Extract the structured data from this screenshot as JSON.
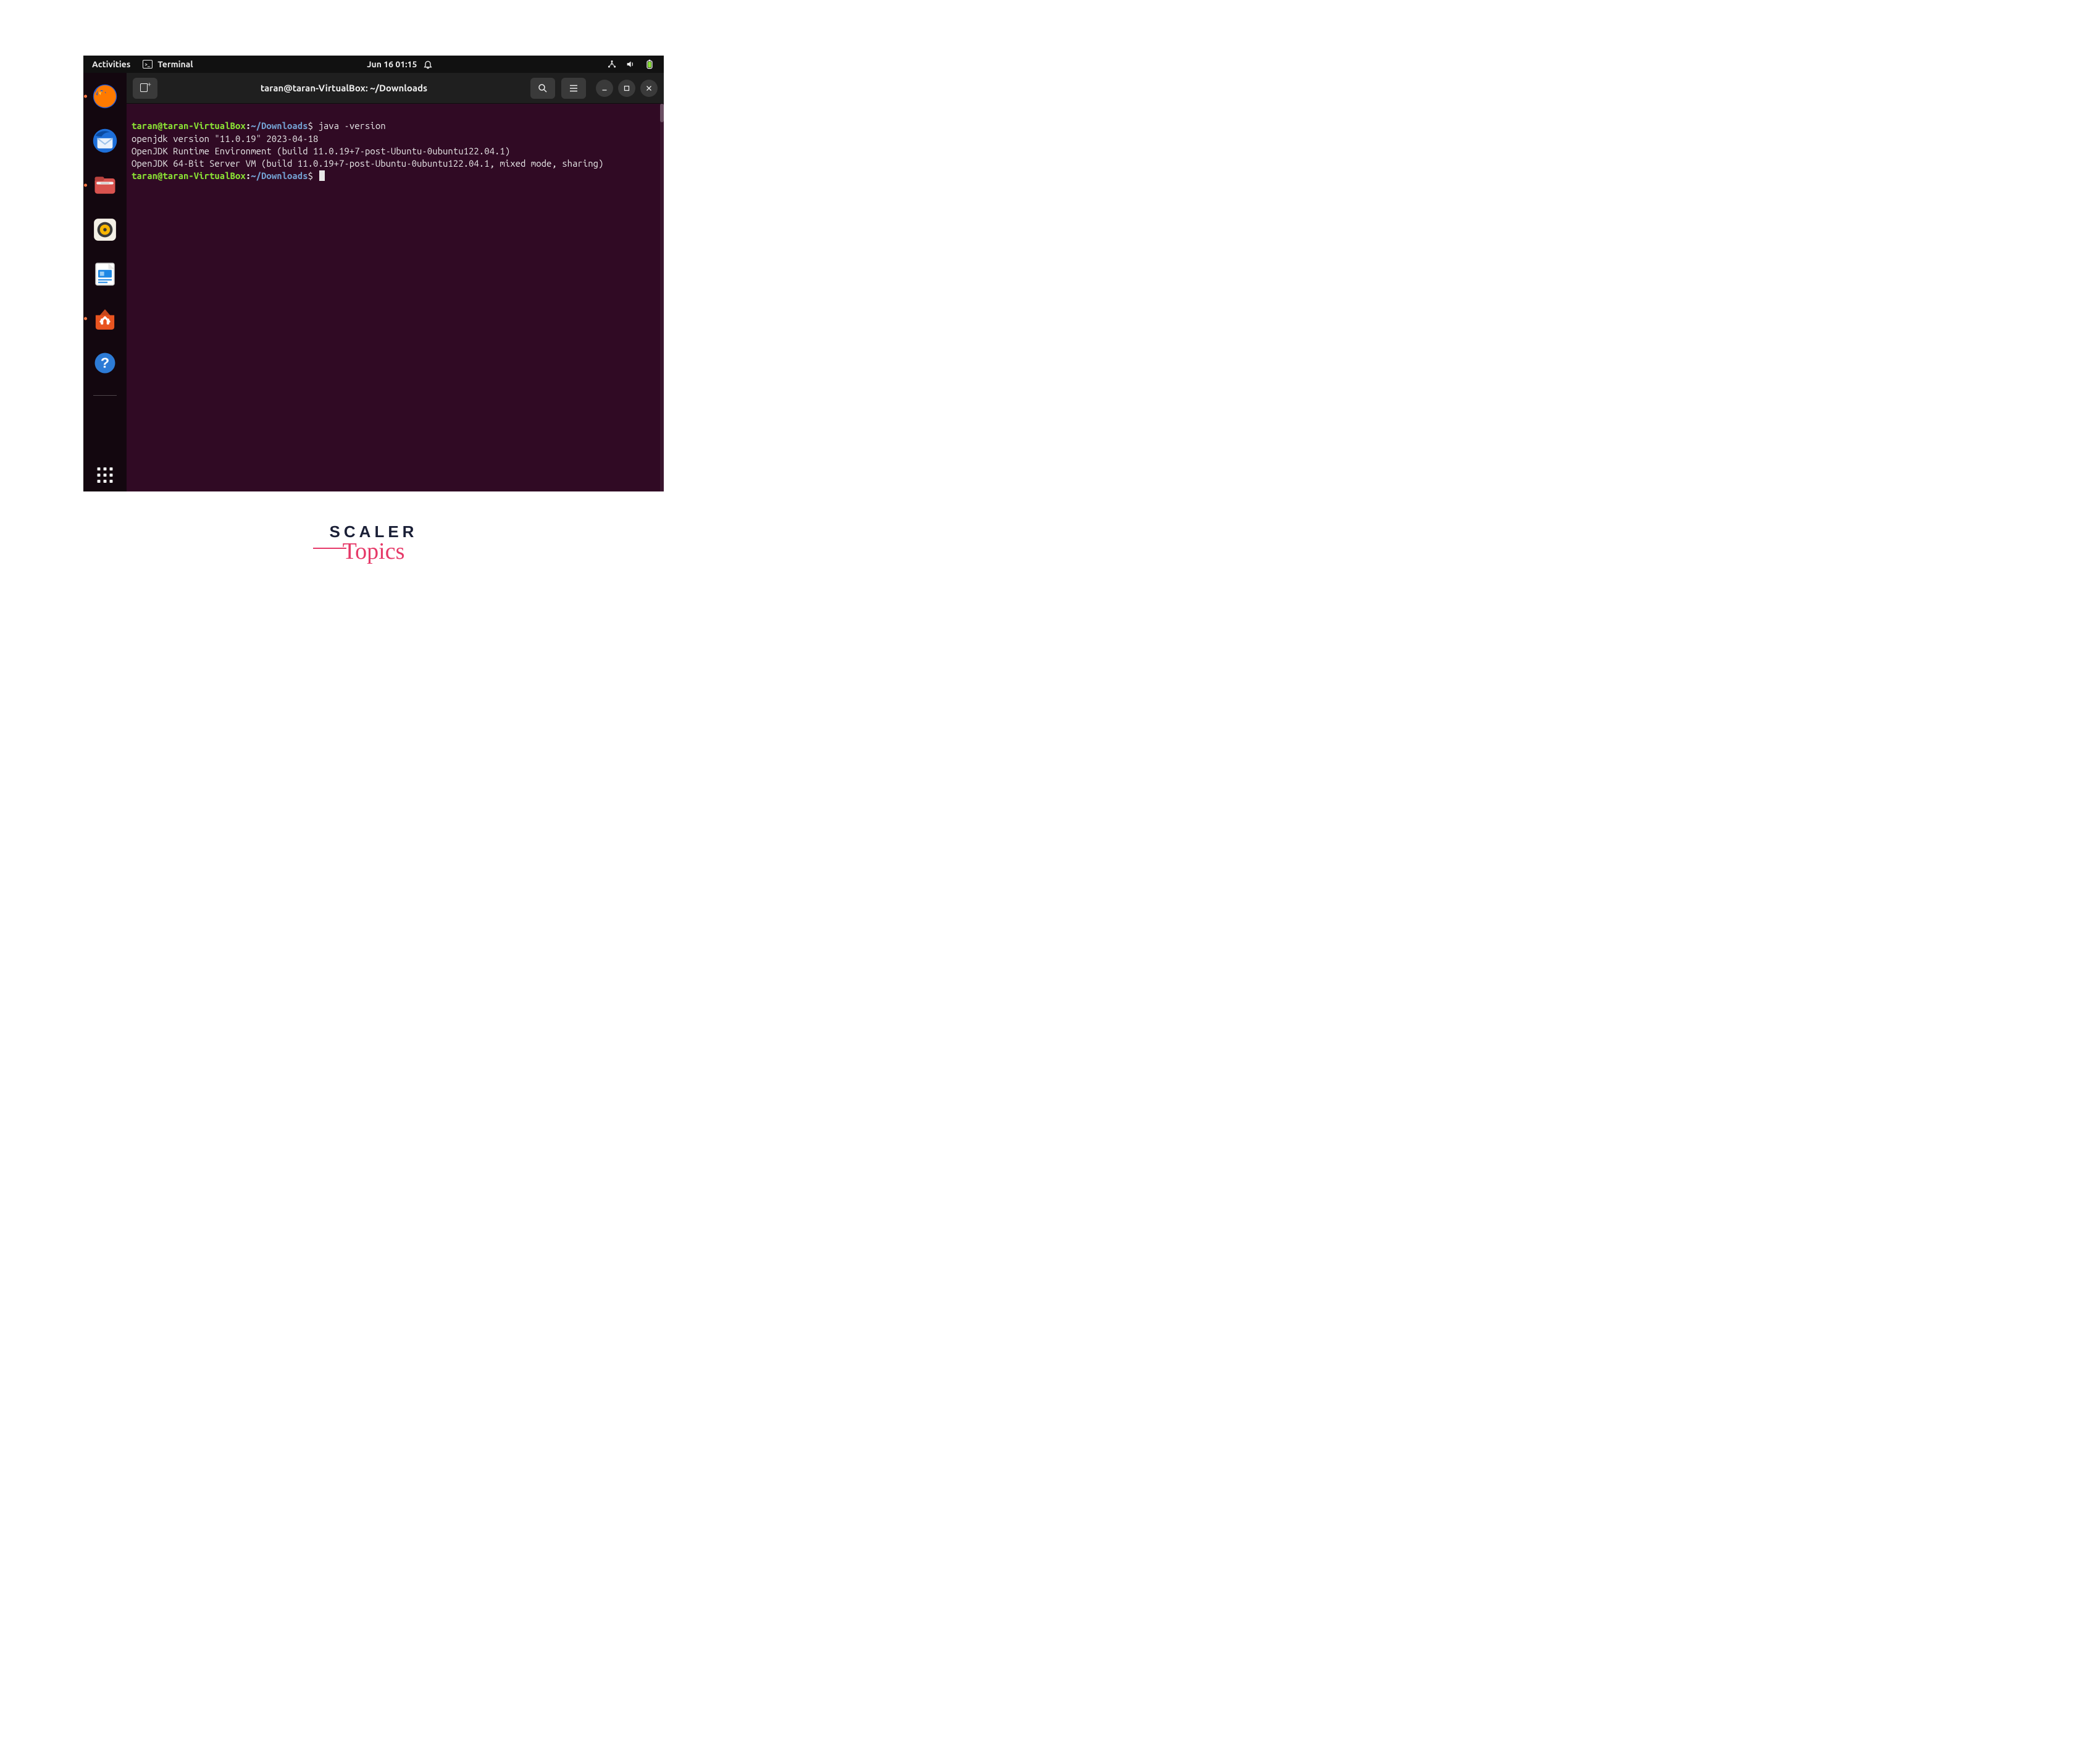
{
  "topbar": {
    "activities": "Activities",
    "app_name": "Terminal",
    "datetime": "Jun 16  01:15"
  },
  "dock": {
    "items": [
      {
        "name": "firefox",
        "running": true
      },
      {
        "name": "thunderbird",
        "running": false
      },
      {
        "name": "files",
        "running": true
      },
      {
        "name": "rhythmbox",
        "running": false
      },
      {
        "name": "libreoffice-writer",
        "running": false
      },
      {
        "name": "ubuntu-software",
        "running": true
      },
      {
        "name": "help",
        "running": false
      }
    ]
  },
  "window": {
    "title": "taran@taran-VirtualBox: ~/Downloads"
  },
  "terminal": {
    "prompt_user": "taran@taran-VirtualBox",
    "prompt_sep": ":",
    "prompt_path": "~/Downloads",
    "prompt_symbol": "$",
    "command": " java -version",
    "output_lines": [
      "openjdk version \"11.0.19\" 2023-04-18",
      "OpenJDK Runtime Environment (build 11.0.19+7-post-Ubuntu-0ubuntu122.04.1)",
      "OpenJDK 64-Bit Server VM (build 11.0.19+7-post-Ubuntu-0ubuntu122.04.1, mixed mode, sharing)"
    ]
  },
  "branding": {
    "line1": "SCALER",
    "line2": "Topics"
  }
}
